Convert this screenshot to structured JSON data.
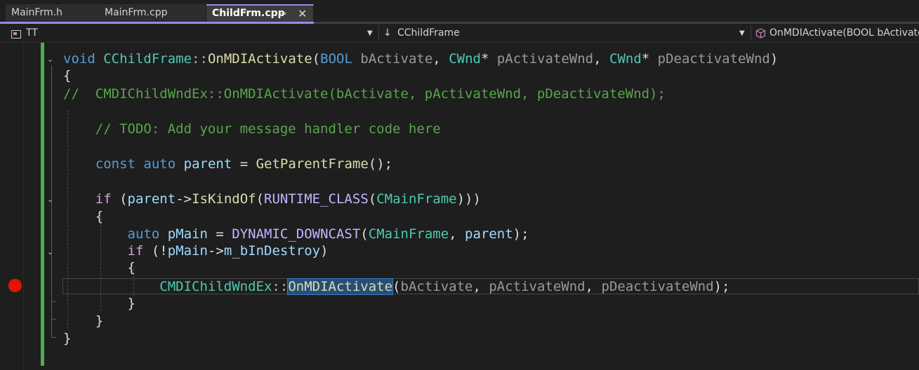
{
  "tabs": [
    {
      "label": "MainFrm.h",
      "active": false
    },
    {
      "label": "MainFrm.cpp",
      "active": false
    },
    {
      "label": "ChildFrm.cpp",
      "active": true,
      "pin_glyph": "⊸",
      "close_glyph": "✕"
    }
  ],
  "navbar": {
    "project": "TT",
    "class_scope": "CChildFrame",
    "class_scope_icon": "↓",
    "member": "OnMDIActivate(BOOL bActivate,",
    "member_icon": "cube-icon",
    "caret": "▼"
  },
  "editor": {
    "fold_glyph": "⌄",
    "lines": [
      {
        "segments": [
          [
            "kw",
            "void"
          ],
          [
            "plain",
            " "
          ],
          [
            "type",
            "CChildFrame"
          ],
          [
            "punct",
            "::"
          ],
          [
            "fn",
            "OnMDIActivate"
          ],
          [
            "plain",
            "("
          ],
          [
            "kw",
            "BOOL"
          ],
          [
            "plain",
            " "
          ],
          [
            "param",
            "bActivate"
          ],
          [
            "plain",
            ", "
          ],
          [
            "type",
            "CWnd"
          ],
          [
            "plain",
            "* "
          ],
          [
            "param",
            "pActivateWnd"
          ],
          [
            "plain",
            ", "
          ],
          [
            "type",
            "CWnd"
          ],
          [
            "plain",
            "* "
          ],
          [
            "param",
            "pDeactivateWnd"
          ],
          [
            "plain",
            ")"
          ]
        ]
      },
      {
        "segments": [
          [
            "plain",
            "{"
          ]
        ]
      },
      {
        "segments": [
          [
            "comment",
            "//  CMDIChildWndEx::OnMDIActivate(bActivate, pActivateWnd, pDeactivateWnd);"
          ]
        ]
      },
      {
        "segments": [
          [
            "plain",
            ""
          ]
        ]
      },
      {
        "segments": [
          [
            "plain",
            "    "
          ],
          [
            "comment",
            "// TODO: Add your message handler code here"
          ]
        ]
      },
      {
        "segments": [
          [
            "plain",
            ""
          ]
        ]
      },
      {
        "segments": [
          [
            "plain",
            "    "
          ],
          [
            "kw",
            "const"
          ],
          [
            "plain",
            " "
          ],
          [
            "kw",
            "auto"
          ],
          [
            "plain",
            " "
          ],
          [
            "var",
            "parent"
          ],
          [
            "plain",
            " = "
          ],
          [
            "fn",
            "GetParentFrame"
          ],
          [
            "plain",
            "();"
          ]
        ]
      },
      {
        "segments": [
          [
            "plain",
            ""
          ]
        ]
      },
      {
        "segments": [
          [
            "plain",
            "    "
          ],
          [
            "kw2",
            "if"
          ],
          [
            "plain",
            " ("
          ],
          [
            "var",
            "parent"
          ],
          [
            "plain",
            "->"
          ],
          [
            "fn",
            "IsKindOf"
          ],
          [
            "plain",
            "("
          ],
          [
            "macro",
            "RUNTIME_CLASS"
          ],
          [
            "plain",
            "("
          ],
          [
            "type",
            "CMainFrame"
          ],
          [
            "plain",
            ")))"
          ]
        ]
      },
      {
        "segments": [
          [
            "plain",
            "    {"
          ]
        ]
      },
      {
        "segments": [
          [
            "plain",
            "        "
          ],
          [
            "kw",
            "auto"
          ],
          [
            "plain",
            " "
          ],
          [
            "var",
            "pMain"
          ],
          [
            "plain",
            " = "
          ],
          [
            "macro",
            "DYNAMIC_DOWNCAST"
          ],
          [
            "plain",
            "("
          ],
          [
            "type",
            "CMainFrame"
          ],
          [
            "plain",
            ", "
          ],
          [
            "var",
            "parent"
          ],
          [
            "plain",
            ");"
          ]
        ]
      },
      {
        "segments": [
          [
            "plain",
            "        "
          ],
          [
            "kw2",
            "if"
          ],
          [
            "plain",
            " (!"
          ],
          [
            "var",
            "pMain"
          ],
          [
            "plain",
            "->"
          ],
          [
            "var",
            "m_bInDestroy"
          ],
          [
            "plain",
            ")"
          ]
        ]
      },
      {
        "segments": [
          [
            "plain",
            "        {"
          ]
        ]
      },
      {
        "segments": [
          [
            "plain",
            "            "
          ],
          [
            "type",
            "CMDIChildWndEx"
          ],
          [
            "punct",
            "::"
          ],
          [
            "fnhl",
            "OnMDIActivate"
          ],
          [
            "plain",
            "("
          ],
          [
            "param",
            "bActivate"
          ],
          [
            "plain",
            ", "
          ],
          [
            "param",
            "pActivateWnd"
          ],
          [
            "plain",
            ", "
          ],
          [
            "param",
            "pDeactivateWnd"
          ],
          [
            "plain",
            ");"
          ]
        ]
      },
      {
        "segments": [
          [
            "plain",
            "        }"
          ]
        ]
      },
      {
        "segments": [
          [
            "plain",
            "    }"
          ]
        ]
      },
      {
        "segments": [
          [
            "plain",
            "}"
          ]
        ]
      }
    ]
  }
}
